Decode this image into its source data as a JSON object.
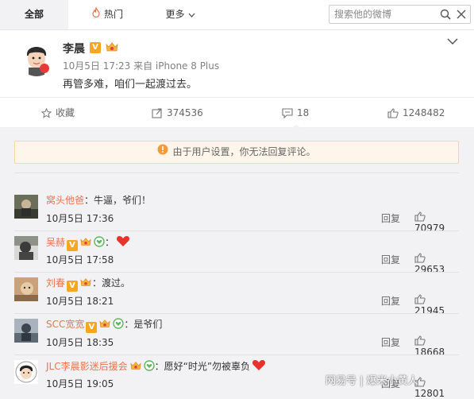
{
  "tabs": [
    {
      "label": "全部",
      "active": true
    },
    {
      "label": "热门",
      "icon": "flame-icon"
    },
    {
      "label": "更多",
      "icon": "caret-down-icon"
    }
  ],
  "search": {
    "placeholder": "搜索他的微博"
  },
  "post": {
    "author": "李晨",
    "verified_badge": "V",
    "meta": "10月5日 17:23 来自 iPhone 8 Plus",
    "text": "再管多难，咱们一起渡过去。"
  },
  "actions": {
    "favorite": "收藏",
    "repost": "374536",
    "comment": "18",
    "like": "1248482"
  },
  "notice": "由于用户设置，你无法回复评论。",
  "comments": [
    {
      "name": "窝头他爸",
      "sep": "：",
      "text": "牛逼，爷们！",
      "time": "10月5日 17:36",
      "reply": "回复",
      "likes": "70979"
    },
    {
      "name": "吴赫",
      "sep": "：",
      "text": "",
      "time": "10月5日 17:58",
      "reply": "回复",
      "likes": "29653"
    },
    {
      "name": "刘春",
      "sep": "：",
      "text": "渡过。",
      "time": "10月5日 18:21",
      "reply": "回复",
      "likes": "21945"
    },
    {
      "name": "SCC宽宽",
      "sep": "：",
      "text": "是爷们",
      "time": "10月5日 18:35",
      "reply": "回复",
      "likes": "18668"
    },
    {
      "name": "JLC李晨影迷后援会",
      "sep": "：",
      "text": "愿好“时光”勿被辜负",
      "time": "10月5日 19:05",
      "reply": "回复",
      "likes": "12801"
    }
  ],
  "watermark": "网易号 | 爆米小黄人",
  "colors": {
    "accent": "#eb7350",
    "notice_bg": "#fef6ea",
    "badge": "#f5a623"
  }
}
